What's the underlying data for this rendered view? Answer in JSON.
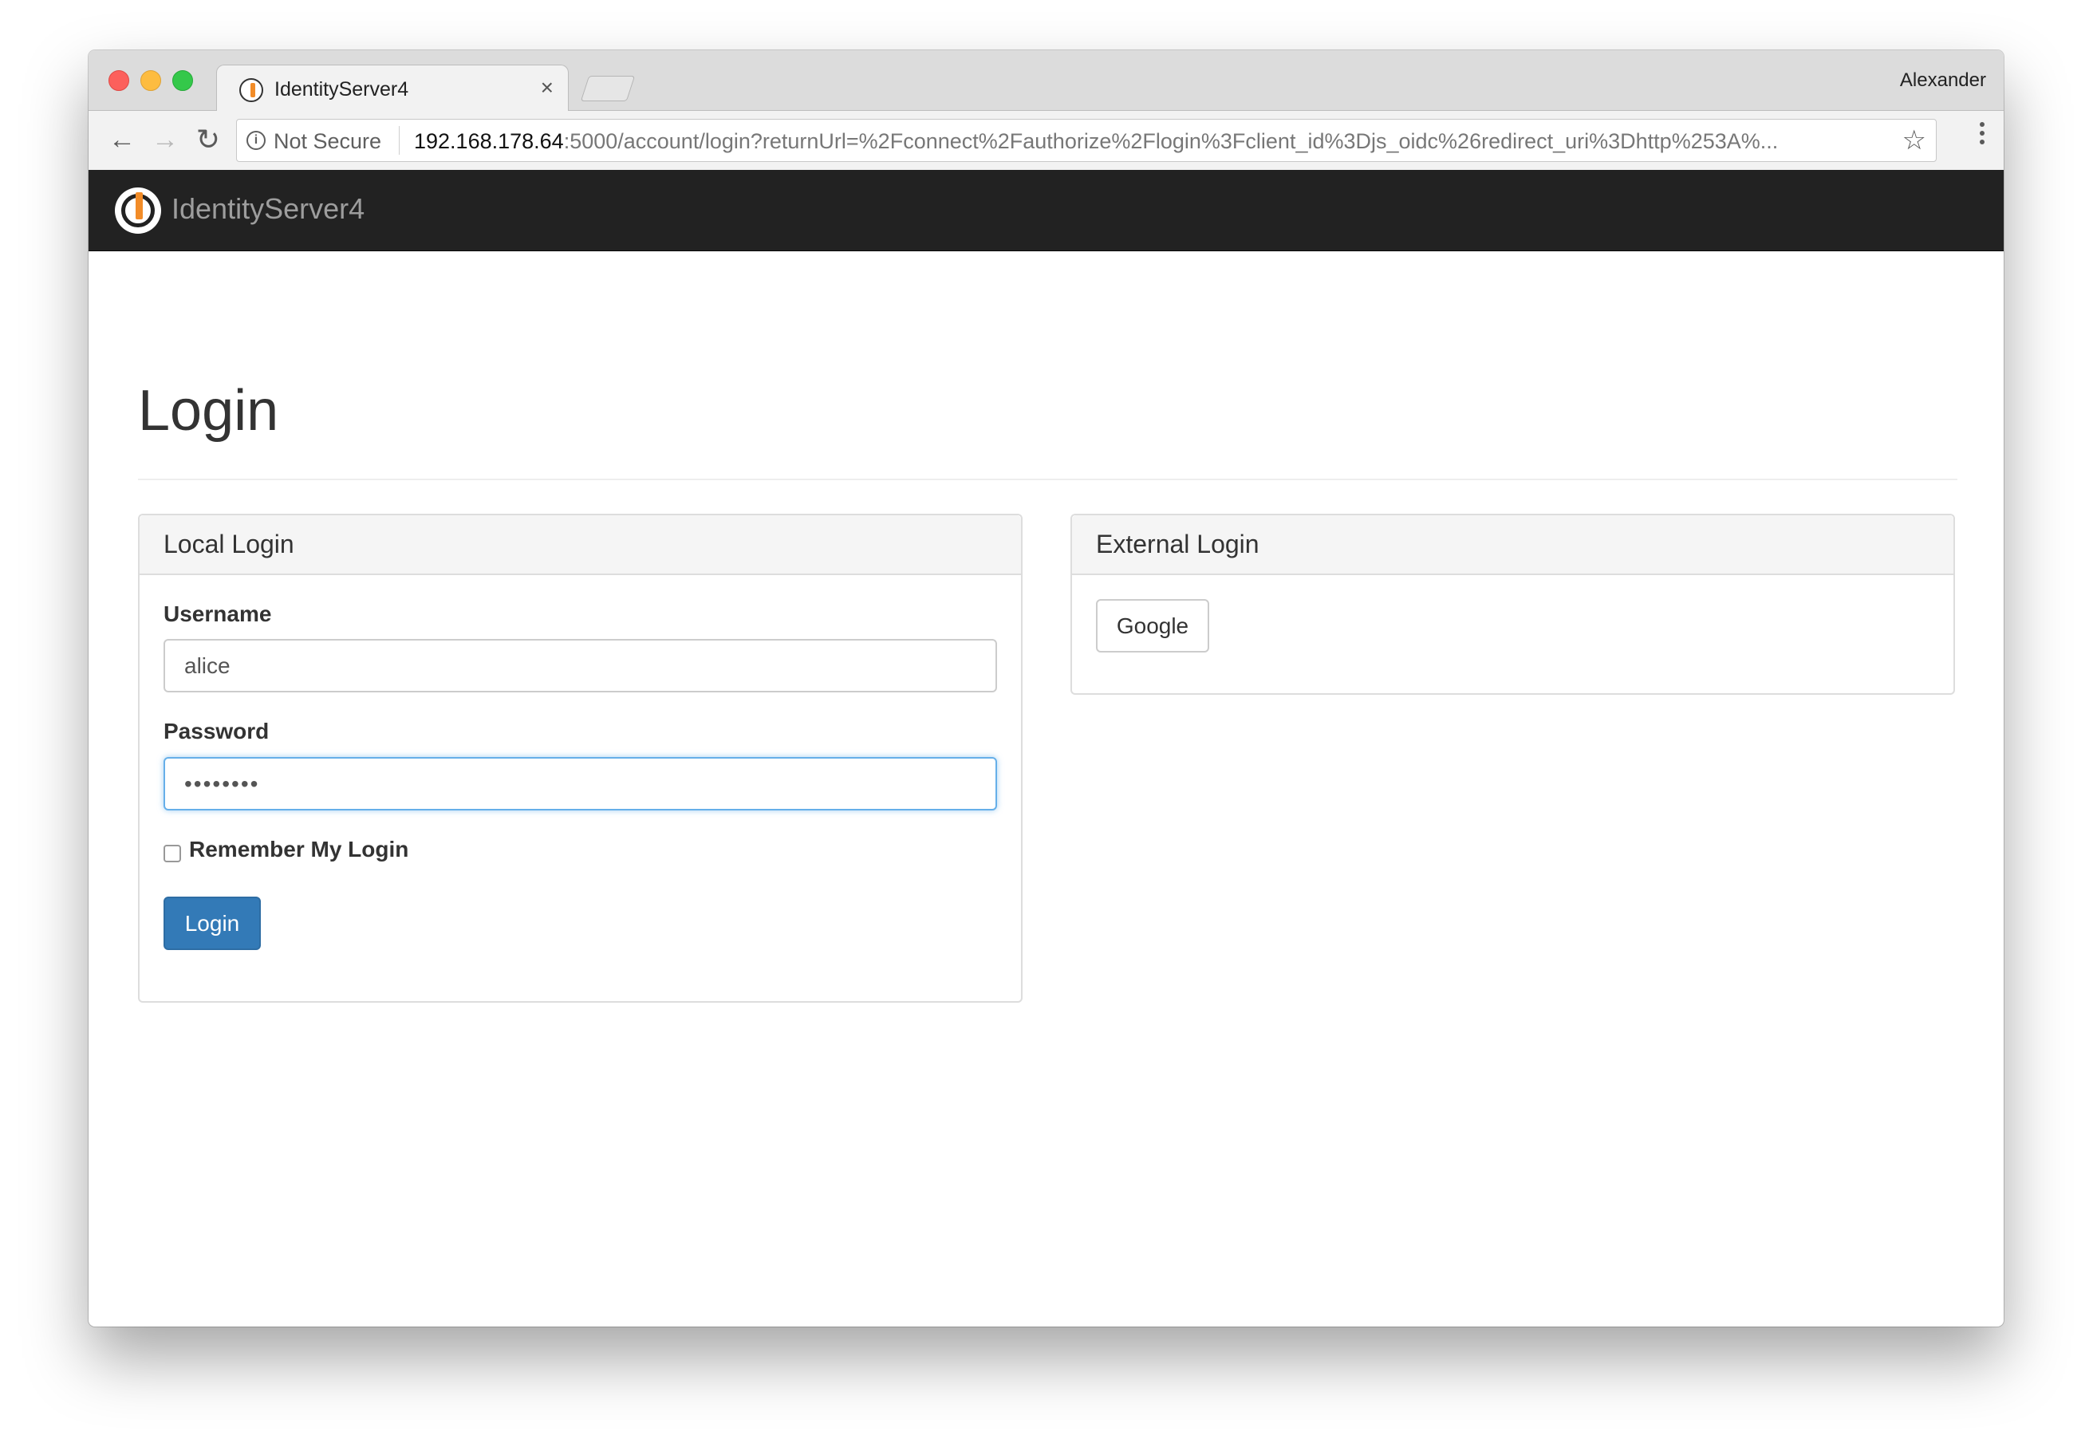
{
  "browser": {
    "tab_title": "IdentityServer4",
    "tab_close": "×",
    "profile_name": "Alexander",
    "security_label": "Not Secure",
    "url_host": "192.168.178.64",
    "url_rest": ":5000/account/login?returnUrl=%2Fconnect%2Fauthorize%2Flogin%3Fclient_id%3Djs_oidc%26redirect_uri%3Dhttp%253A%...",
    "icons": {
      "back": "←",
      "forward": "→",
      "reload": "↻",
      "star": "☆",
      "info": "i"
    }
  },
  "navbar": {
    "brand": "IdentityServer4"
  },
  "page": {
    "title": "Login"
  },
  "local_login": {
    "heading": "Local Login",
    "username_label": "Username",
    "username_value": "alice",
    "password_label": "Password",
    "password_value": "••••••••",
    "remember_label": "Remember My Login",
    "remember_checked": false,
    "submit_label": "Login"
  },
  "external_login": {
    "heading": "External Login",
    "providers": [
      "Google"
    ]
  },
  "colors": {
    "navbar_bg": "#222222",
    "brand_text": "#9d9d9d",
    "primary_button": "#337ab7",
    "focus_border": "#66afe9",
    "logo_accent": "#f28c28"
  }
}
